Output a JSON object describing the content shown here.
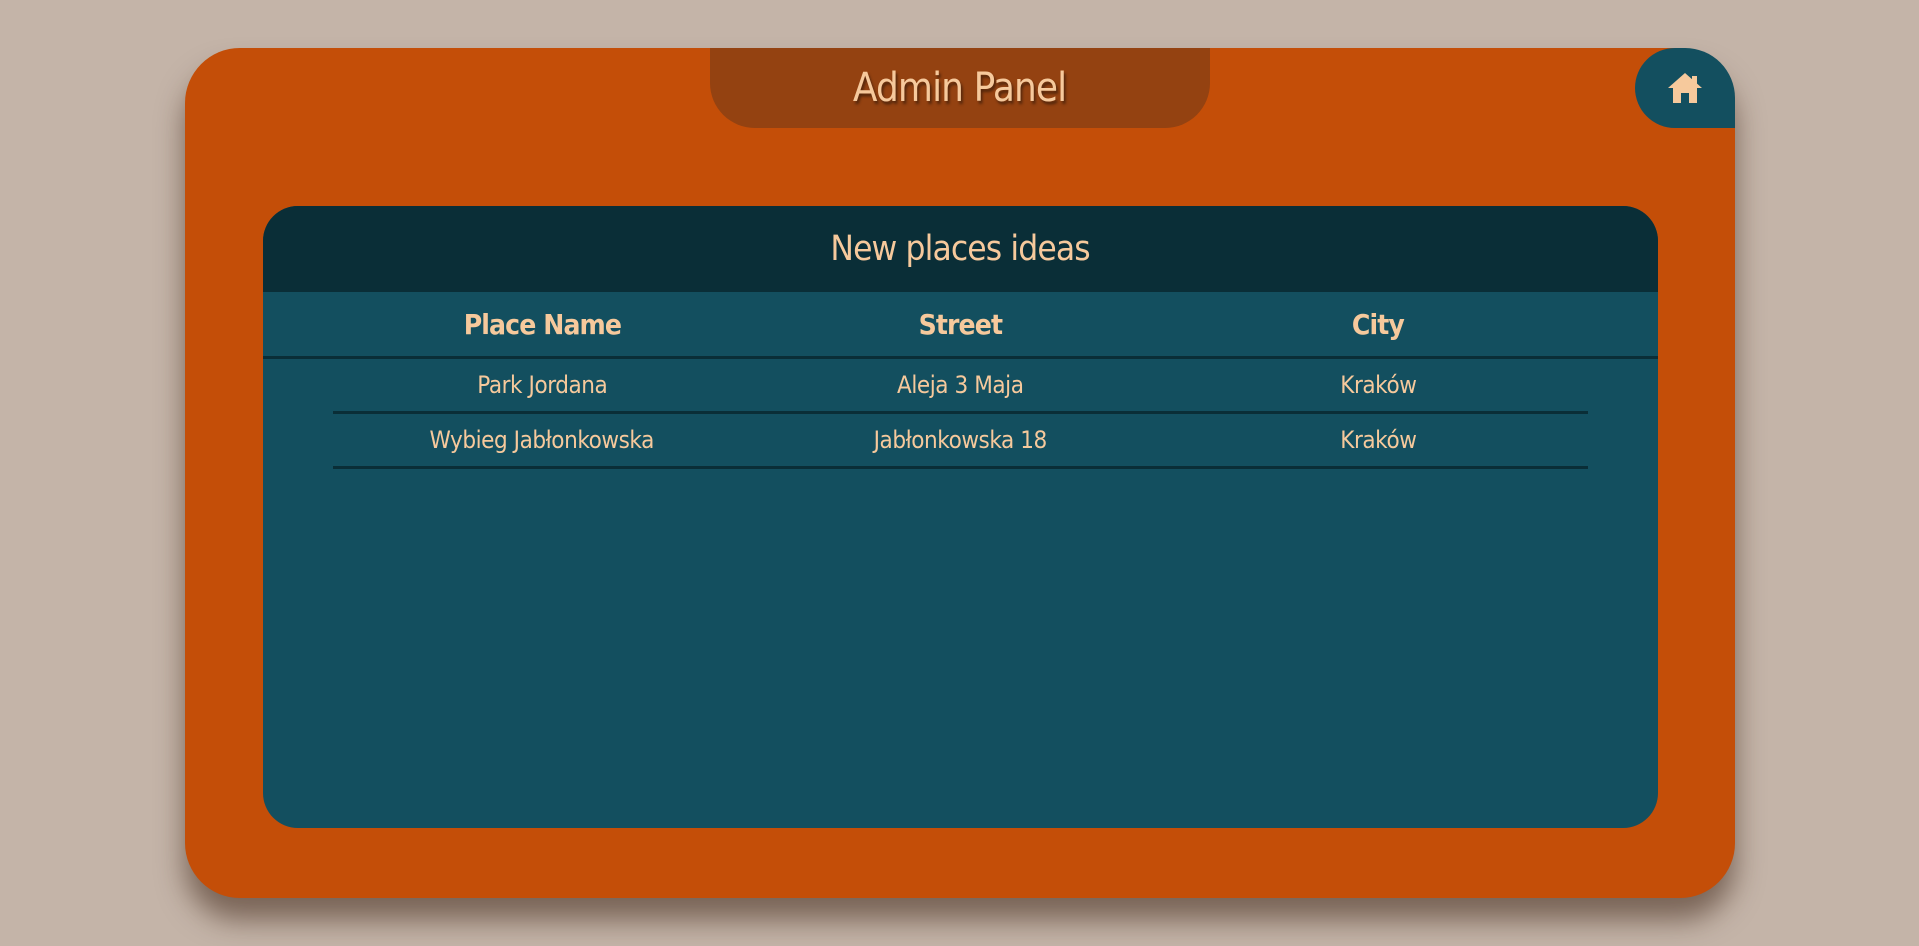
{
  "header": {
    "title": "Admin Panel",
    "home_icon": "home-icon"
  },
  "card": {
    "title": "New places ideas"
  },
  "table": {
    "columns": [
      "Place Name",
      "Street",
      "City"
    ],
    "rows": [
      [
        "Park Jordana",
        "Aleja 3 Maja",
        "Kraków"
      ],
      [
        "Wybieg Jabłonkowska",
        "Jabłonkowska 18",
        "Kraków"
      ]
    ]
  },
  "colors": {
    "background": "#c4b4a8",
    "panel": "#c44e08",
    "title_tab": "#944211",
    "card": "#134f5f",
    "card_header": "#0a2e37",
    "text": "#f6c99c"
  }
}
